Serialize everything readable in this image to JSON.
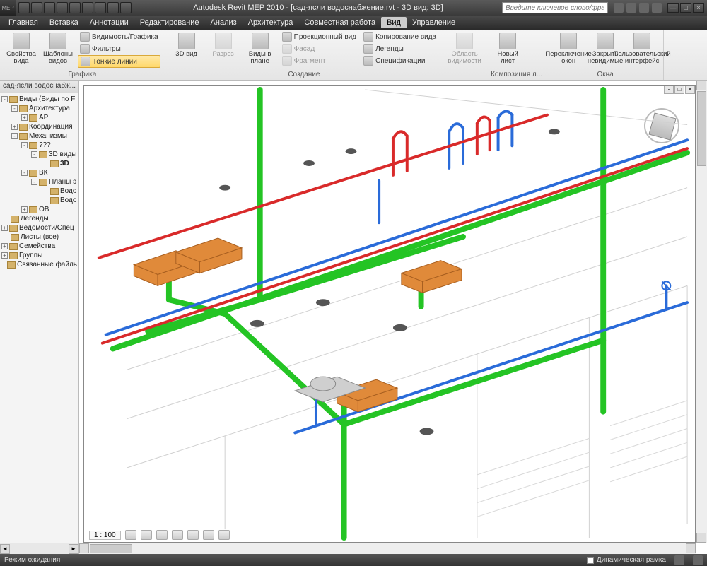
{
  "titlebar": {
    "app_label": "MEP",
    "title": "Autodesk Revit MEP 2010 - [сад-ясли водоснабжение.rvt - 3D вид: 3D]",
    "search_placeholder": "Введите ключевое слово/фразу",
    "win_min": "—",
    "win_max": "□",
    "win_close": "×"
  },
  "menubar": {
    "items": [
      "Главная",
      "Вставка",
      "Аннотации",
      "Редактирование",
      "Анализ",
      "Архитектура",
      "Совместная работа",
      "Вид",
      "Управление"
    ],
    "active_index": 7
  },
  "ribbon": {
    "groups": [
      {
        "label": "Графика",
        "big": [
          {
            "label": "Свойства вида",
            "name": "view-properties"
          },
          {
            "label": "Шаблоны видов",
            "name": "view-templates"
          }
        ],
        "small": [
          {
            "label": "Видимость/Графика",
            "name": "visibility-graphics"
          },
          {
            "label": "Фильтры",
            "name": "filters"
          },
          {
            "label": "Тонкие линии",
            "name": "thin-lines",
            "pressed": true
          }
        ]
      },
      {
        "label": "Создание",
        "big": [
          {
            "label": "3D вид",
            "name": "3d-view"
          },
          {
            "label": "Разрез",
            "name": "section",
            "disabled": true
          },
          {
            "label": "Виды в плане",
            "name": "plan-views"
          }
        ],
        "small": [
          {
            "label": "Проекционный вид",
            "name": "elevation-view"
          },
          {
            "label": "Фасад",
            "name": "facade",
            "disabled": true
          },
          {
            "label": "Фрагмент",
            "name": "callout",
            "disabled": true
          }
        ],
        "small2": [
          {
            "label": "Копирование вида",
            "name": "duplicate-view"
          },
          {
            "label": "Легенды",
            "name": "legends"
          },
          {
            "label": "Спецификации",
            "name": "schedules"
          }
        ]
      },
      {
        "label": "",
        "big": [
          {
            "label": "Область видимости",
            "name": "scope-box",
            "disabled": true
          }
        ]
      },
      {
        "label": "Композиция л...",
        "big": [
          {
            "label": "Новый лист",
            "name": "new-sheet"
          }
        ],
        "small": []
      },
      {
        "label": "Окна",
        "big": [
          {
            "label": "Переключение окон",
            "name": "switch-windows"
          },
          {
            "label": "Закрыть невидимые",
            "name": "close-hidden"
          },
          {
            "label": "Пользовательский интерфейс",
            "name": "user-interface"
          }
        ]
      }
    ]
  },
  "sidebar": {
    "tab": "сад-ясли водоснабж...",
    "tree": [
      {
        "level": 1,
        "exp": "-",
        "label": "Виды (Виды по F",
        "type": "root"
      },
      {
        "level": 2,
        "exp": "-",
        "label": "Архитектура"
      },
      {
        "level": 3,
        "exp": "+",
        "label": "АР"
      },
      {
        "level": 2,
        "exp": "+",
        "label": "Координация"
      },
      {
        "level": 2,
        "exp": "-",
        "label": "Механизмы"
      },
      {
        "level": 3,
        "exp": "-",
        "label": "???"
      },
      {
        "level": 4,
        "exp": "-",
        "label": "3D виды"
      },
      {
        "level": 5,
        "exp": "",
        "label": "3D",
        "sel": true
      },
      {
        "level": 3,
        "exp": "-",
        "label": "ВК"
      },
      {
        "level": 4,
        "exp": "-",
        "label": "Планы э"
      },
      {
        "level": 5,
        "exp": "",
        "label": "Водо"
      },
      {
        "level": 5,
        "exp": "",
        "label": "Водо"
      },
      {
        "level": 3,
        "exp": "+",
        "label": "ОВ"
      },
      {
        "level": 1,
        "exp": "",
        "label": "Легенды",
        "icon": "leg"
      },
      {
        "level": 1,
        "exp": "+",
        "label": "Ведомости/Спец",
        "icon": "sched"
      },
      {
        "level": 1,
        "exp": "",
        "label": "Листы (все)",
        "icon": "sheet"
      },
      {
        "level": 1,
        "exp": "+",
        "label": "Семейства",
        "icon": "fam"
      },
      {
        "level": 1,
        "exp": "+",
        "label": "Группы",
        "icon": "grp"
      },
      {
        "level": 1,
        "exp": "",
        "label": "Связанные файль",
        "icon": "link"
      }
    ]
  },
  "viewport": {
    "doc_min": "-",
    "doc_max": "□",
    "doc_close": "×",
    "scale": "1 : 100"
  },
  "statusbar": {
    "status": "Режим ожидания",
    "checkbox": "Динамическая рамка"
  },
  "colors": {
    "pipe_green": "#24c424",
    "pipe_red": "#d92a2a",
    "pipe_blue": "#2a6bd9",
    "sink": "#e08a3a"
  }
}
